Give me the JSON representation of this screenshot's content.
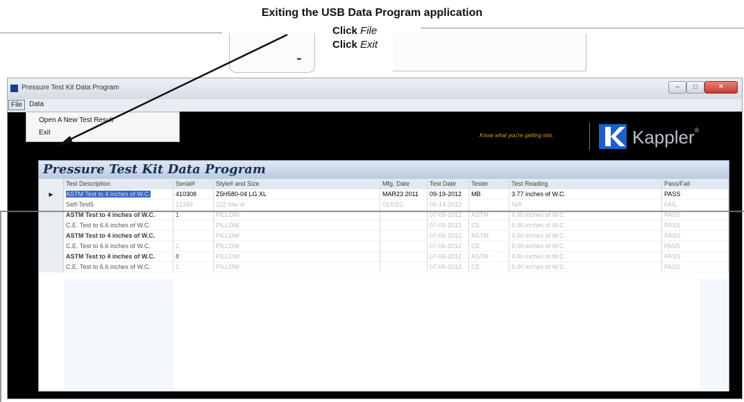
{
  "callout": {
    "title": "Exiting the USB Data Program application",
    "step1_verb": "Click",
    "step1_target": "File",
    "step2_verb": "Click",
    "step2_target": "Exit"
  },
  "window": {
    "title": "Pressure Test Kit Data Program",
    "controls": {
      "minimize": "–",
      "maximize": "□",
      "close": "✕"
    }
  },
  "menu": {
    "file": "File",
    "data": "Data"
  },
  "file_menu": {
    "items": [
      "Open A New Test Result",
      "Exit"
    ]
  },
  "banner": {
    "tagline": "Know what you're getting into.",
    "brand": "Kappler",
    "reg": "®",
    "logo_color": "#1e5fc8",
    "tagline_color": "#d9a400"
  },
  "panel": {
    "title": "Pressure Test Kit Data Program"
  },
  "table": {
    "columns": [
      "Test Description",
      "Serial#",
      "Style# and Size",
      "Mfg. Date",
      "Test Date",
      "Tester",
      "Test Reading",
      "Pass/Fail"
    ],
    "rows": [
      {
        "marker": "▶",
        "cells": [
          "ASTM Test to 4 inches of W.C.",
          "410308",
          "Z5H580-04 LG XL",
          "MAR23 2011",
          "09-19-2012",
          "MB",
          "3.77 inches of W.C.",
          "PASS"
        ]
      },
      {
        "marker": "",
        "cells": [
          "Self-Test5",
          "12345",
          "222 btw st",
          "01/01/2",
          "06-14-2012",
          "",
          "N/A",
          "FAIL"
        ]
      },
      {
        "marker": "",
        "cells": [
          "ASTM Test to 4 inches of W.C.",
          "1",
          "PILLOW",
          "",
          "07-05-2012",
          "ASTM",
          "4.00 inches of W.C.",
          "PASS"
        ]
      },
      {
        "marker": "",
        "cells": [
          "C.E. Test to 6.6 inches of W.C.",
          "",
          "PILLOW",
          "",
          "07-05-2012",
          "CE",
          "6.00 inches of W.C.",
          "PASS"
        ]
      },
      {
        "marker": "",
        "cells": [
          "ASTM Test to 4 inches of W.C.",
          "",
          "PILLOW",
          "",
          "07-06-2012",
          "ASTM",
          "4.00 inches of W.C.",
          "PASS"
        ]
      },
      {
        "marker": "",
        "cells": [
          "C.E. Test to 6.6 inches of W.C.",
          "1",
          "PILLOW",
          "",
          "07-06-2012",
          "CE",
          "6.00 inches of W.C.",
          "PASS"
        ]
      },
      {
        "marker": "",
        "cells": [
          "ASTM Test to 4 inches of W.C.",
          "8",
          "PILLOW",
          "",
          "07-06-2012",
          "ASTM",
          "4.00 inches of W.C.",
          "PASS"
        ]
      },
      {
        "marker": "",
        "cells": [
          "C.E. Test to 6.6 inches of W.C.",
          "1",
          "PILLOW",
          "",
          "07-06-2012",
          "CE",
          "6.00 inches of W.C.",
          "PASS"
        ]
      }
    ]
  }
}
